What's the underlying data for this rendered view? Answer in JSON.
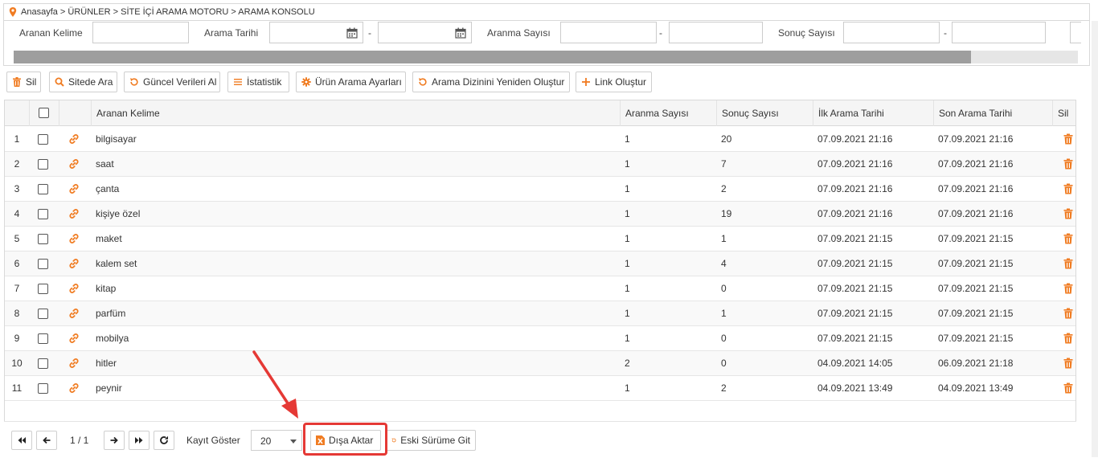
{
  "breadcrumb": {
    "text": "Anasayfa > ÜRÜNLER > SİTE İÇİ ARAMA MOTORU > ARAMA KONSOLU"
  },
  "filters": {
    "keyword_label": "Aranan Kelime",
    "date_label": "Arama Tarihi",
    "search_count_label": "Aranma Sayısı",
    "result_count_label": "Sonuç Sayısı",
    "dash": "-"
  },
  "toolbar": {
    "delete": "Sil",
    "search_site": "Sitede Ara",
    "refresh_data": "Güncel Verileri Al",
    "statistics": "İstatistik",
    "search_settings": "Ürün Arama Ayarları",
    "rebuild_index": "Arama Dizinini Yeniden Oluştur",
    "create_link": "Link Oluştur"
  },
  "table": {
    "headers": [
      "Aranan Kelime",
      "Aranma Sayısı",
      "Sonuç Sayısı",
      "İlk Arama Tarihi",
      "Son Arama Tarihi",
      "Sil"
    ],
    "rows": [
      {
        "no": "1",
        "keyword": "bilgisayar",
        "searches": "1",
        "results": "20",
        "first": "07.09.2021 21:16",
        "last": "07.09.2021 21:16"
      },
      {
        "no": "2",
        "keyword": "saat",
        "searches": "1",
        "results": "7",
        "first": "07.09.2021 21:16",
        "last": "07.09.2021 21:16"
      },
      {
        "no": "3",
        "keyword": "çanta",
        "searches": "1",
        "results": "2",
        "first": "07.09.2021 21:16",
        "last": "07.09.2021 21:16"
      },
      {
        "no": "4",
        "keyword": "kişiye özel",
        "searches": "1",
        "results": "19",
        "first": "07.09.2021 21:16",
        "last": "07.09.2021 21:16"
      },
      {
        "no": "5",
        "keyword": "maket",
        "searches": "1",
        "results": "1",
        "first": "07.09.2021 21:15",
        "last": "07.09.2021 21:15"
      },
      {
        "no": "6",
        "keyword": "kalem set",
        "searches": "1",
        "results": "4",
        "first": "07.09.2021 21:15",
        "last": "07.09.2021 21:15"
      },
      {
        "no": "7",
        "keyword": "kitap",
        "searches": "1",
        "results": "0",
        "first": "07.09.2021 21:15",
        "last": "07.09.2021 21:15"
      },
      {
        "no": "8",
        "keyword": "parfüm",
        "searches": "1",
        "results": "1",
        "first": "07.09.2021 21:15",
        "last": "07.09.2021 21:15"
      },
      {
        "no": "9",
        "keyword": "mobilya",
        "searches": "1",
        "results": "0",
        "first": "07.09.2021 21:15",
        "last": "07.09.2021 21:15"
      },
      {
        "no": "10",
        "keyword": "hitler",
        "searches": "2",
        "results": "0",
        "first": "04.09.2021 14:05",
        "last": "06.09.2021 21:18"
      },
      {
        "no": "11",
        "keyword": "peynir",
        "searches": "1",
        "results": "2",
        "first": "04.09.2021 13:49",
        "last": "04.09.2021 13:49"
      }
    ]
  },
  "pager": {
    "page_info": "1 / 1",
    "show_label": "Kayıt Göster",
    "page_size": "20",
    "export": "Dışa Aktar",
    "old_version": "Eski Sürüme Git"
  },
  "colors": {
    "accent": "#f07c22",
    "highlight": "#e53935",
    "scrollbar": "#9e9e9e"
  },
  "icons": [
    "location-pin-icon",
    "calendar-icon",
    "trash-icon",
    "search-icon",
    "refresh-icon",
    "list-icon",
    "gear-icon",
    "plus-icon",
    "link-icon",
    "first-page-icon",
    "prev-page-icon",
    "next-page-icon",
    "last-page-icon",
    "reload-icon",
    "excel-icon",
    "undo-icon"
  ]
}
